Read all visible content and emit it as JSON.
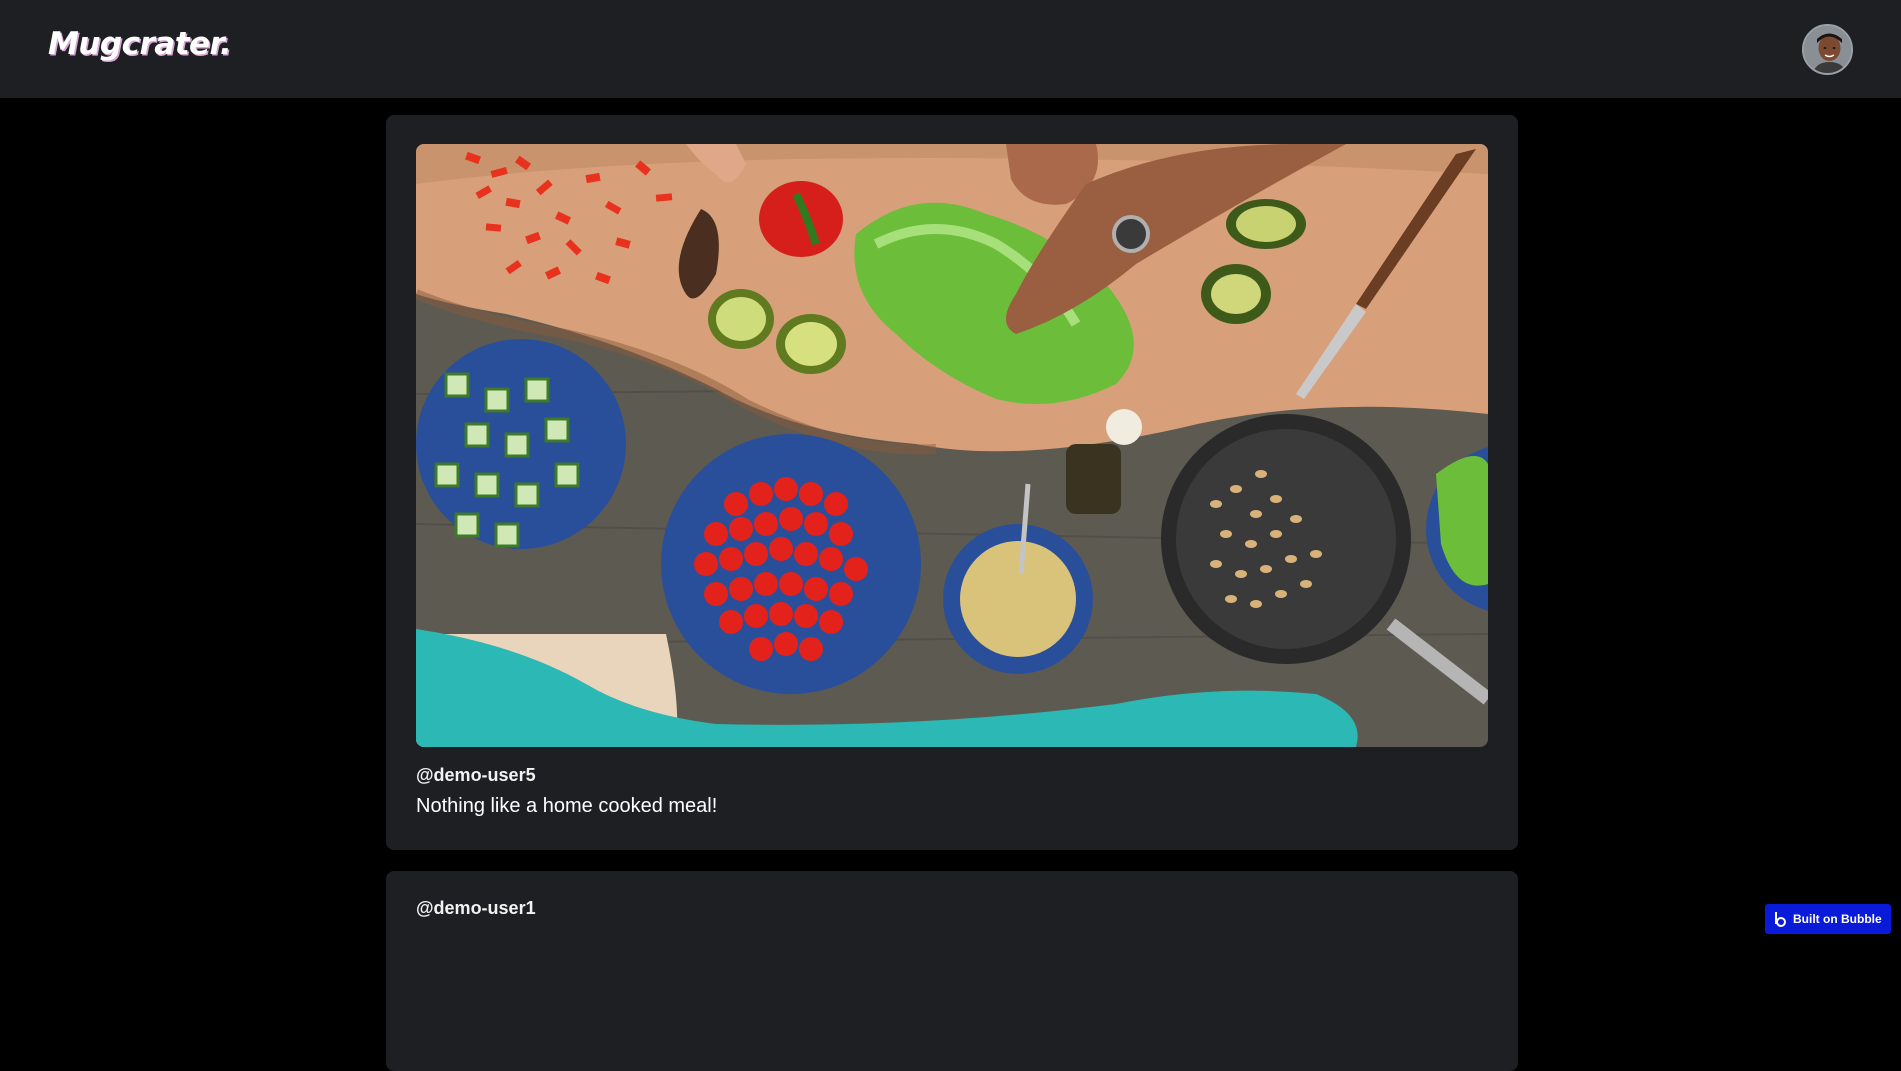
{
  "header": {
    "logo_text": "Mugcrater.",
    "avatar_alt": "user avatar"
  },
  "feed": {
    "posts": [
      {
        "username": "@demo-user5",
        "caption": "Nothing like a home cooked meal!",
        "has_image": true
      },
      {
        "username": "@demo-user1",
        "caption": "",
        "has_image": false
      }
    ]
  },
  "badge": {
    "label": "Built on Bubble"
  },
  "colors": {
    "page_bg": "#000000",
    "header_bg": "#1e1f22",
    "card_bg": "#1e1f22",
    "badge_bg": "#0a1ad9"
  }
}
